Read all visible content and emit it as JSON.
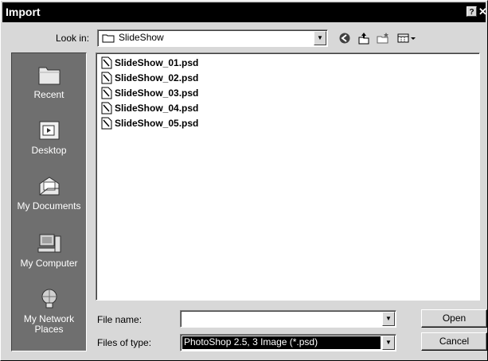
{
  "window": {
    "title": "Import",
    "help_label": "?",
    "close_label": "✕"
  },
  "lookin": {
    "label": "Look in:",
    "value": "SlideShow",
    "dropdown_arrow": "▼"
  },
  "toolbar": {
    "icons": [
      "back-icon",
      "up-folder-icon",
      "new-folder-icon",
      "view-menu-icon"
    ]
  },
  "places": [
    {
      "label": "Recent",
      "icon": "recent-folder-icon"
    },
    {
      "label": "Desktop",
      "icon": "desktop-icon"
    },
    {
      "label": "My Documents",
      "icon": "my-documents-icon"
    },
    {
      "label": "My Computer",
      "icon": "my-computer-icon"
    },
    {
      "label": "My Network Places",
      "icon": "network-places-icon"
    }
  ],
  "files": [
    "SlideShow_01.psd",
    "SlideShow_02.psd",
    "SlideShow_03.psd",
    "SlideShow_04.psd",
    "SlideShow_05.psd"
  ],
  "filename": {
    "label": "File name:",
    "value": ""
  },
  "filetype": {
    "label": "Files of type:",
    "value": "PhotoShop 2.5, 3 Image (*.psd)"
  },
  "buttons": {
    "open": "Open",
    "cancel": "Cancel"
  },
  "colors": {
    "title_bar": "#000000",
    "dialog_bg": "#d8d8d8",
    "places_bar": "#6f6f6f",
    "selection": "#000000"
  }
}
